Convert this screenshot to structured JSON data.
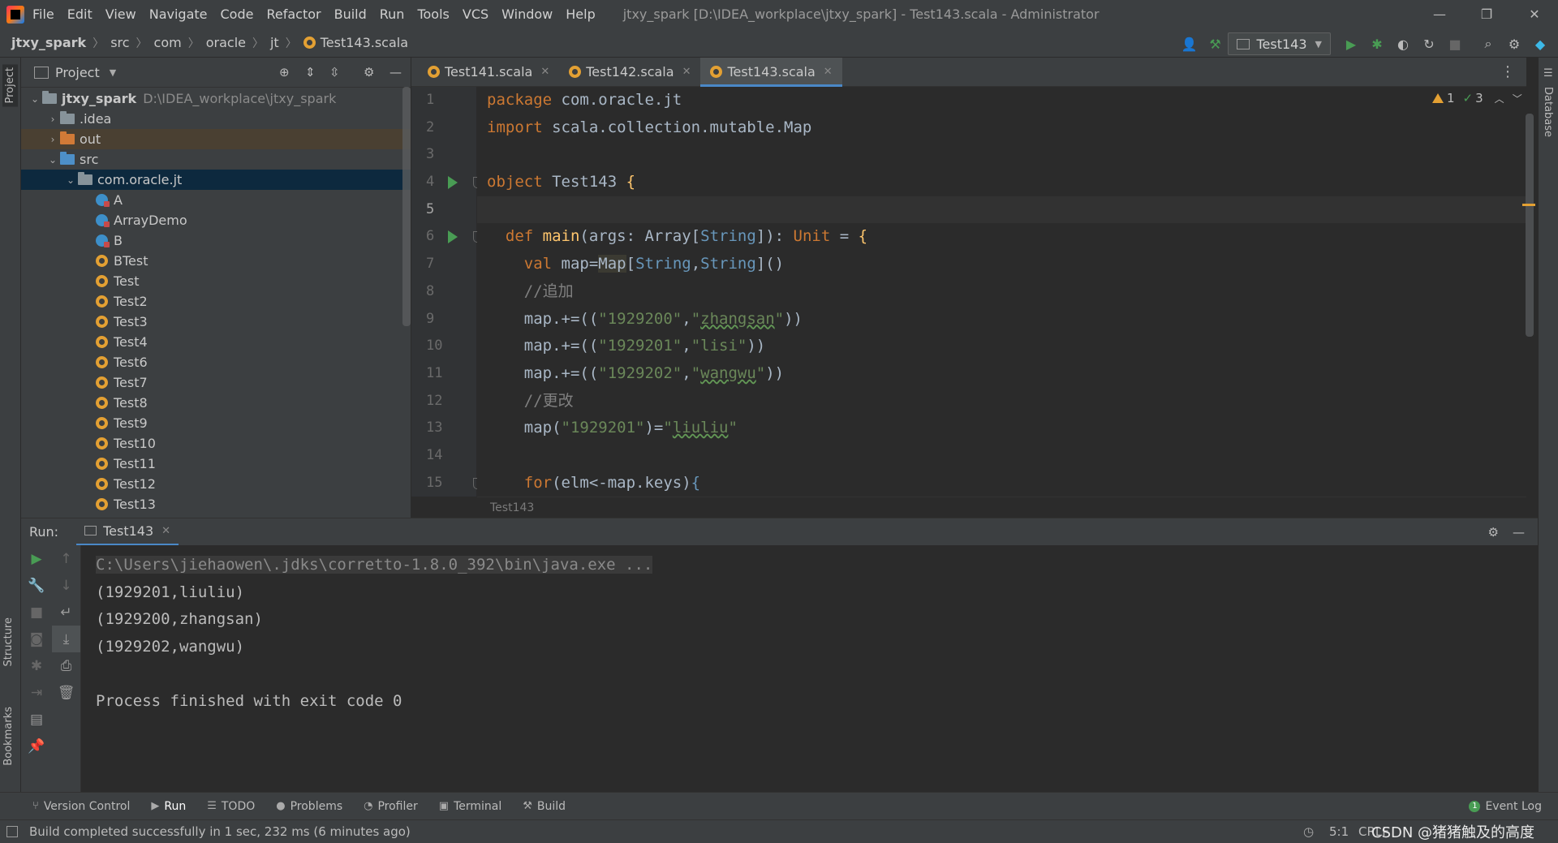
{
  "menu": {
    "items": [
      "File",
      "Edit",
      "View",
      "Navigate",
      "Code",
      "Refactor",
      "Build",
      "Run",
      "Tools",
      "VCS",
      "Window",
      "Help"
    ],
    "window_title": "jtxy_spark [D:\\IDEA_workplace\\jtxy_spark] - Test143.scala - Administrator",
    "minimize": "—",
    "restore": "❐",
    "close": "✕"
  },
  "nav": {
    "crumbs": [
      "jtxy_spark",
      "src",
      "com",
      "oracle",
      "jt",
      "Test143.scala"
    ],
    "run_config": "Test143"
  },
  "project": {
    "title": "Project",
    "tree": [
      {
        "label": "jtxy_spark",
        "extra": "D:\\IDEA_workplace\\jtxy_spark",
        "depth": 0,
        "kind": "module",
        "open": true
      },
      {
        "label": ".idea",
        "depth": 1,
        "kind": "folder",
        "open": false
      },
      {
        "label": "out",
        "depth": 1,
        "kind": "folder-orange",
        "open": false
      },
      {
        "label": "src",
        "depth": 1,
        "kind": "folder-blue",
        "open": true
      },
      {
        "label": "com.oracle.jt",
        "depth": 2,
        "kind": "package",
        "open": true
      },
      {
        "label": "A",
        "depth": 3,
        "kind": "class"
      },
      {
        "label": "ArrayDemo",
        "depth": 3,
        "kind": "class"
      },
      {
        "label": "B",
        "depth": 3,
        "kind": "class"
      },
      {
        "label": "BTest",
        "depth": 3,
        "kind": "object"
      },
      {
        "label": "Test",
        "depth": 3,
        "kind": "object"
      },
      {
        "label": "Test2",
        "depth": 3,
        "kind": "object"
      },
      {
        "label": "Test3",
        "depth": 3,
        "kind": "object"
      },
      {
        "label": "Test4",
        "depth": 3,
        "kind": "object"
      },
      {
        "label": "Test6",
        "depth": 3,
        "kind": "object"
      },
      {
        "label": "Test7",
        "depth": 3,
        "kind": "object"
      },
      {
        "label": "Test8",
        "depth": 3,
        "kind": "object"
      },
      {
        "label": "Test9",
        "depth": 3,
        "kind": "object"
      },
      {
        "label": "Test10",
        "depth": 3,
        "kind": "object"
      },
      {
        "label": "Test11",
        "depth": 3,
        "kind": "object"
      },
      {
        "label": "Test12",
        "depth": 3,
        "kind": "object"
      },
      {
        "label": "Test13",
        "depth": 3,
        "kind": "object"
      }
    ]
  },
  "editor": {
    "tabs": [
      {
        "label": "Test141.scala",
        "active": false
      },
      {
        "label": "Test142.scala",
        "active": false
      },
      {
        "label": "Test143.scala",
        "active": true
      }
    ],
    "line_numbers": [
      "1",
      "2",
      "3",
      "4",
      "5",
      "6",
      "7",
      "8",
      "9",
      "10",
      "11",
      "12",
      "13",
      "14",
      "15"
    ],
    "current_line": "5",
    "warnings": "1",
    "checks": "3",
    "footer": "Test143",
    "lines": {
      "l1a": "package",
      "l1b": " com.oracle.jt",
      "l2a": "import",
      "l2b": " scala.collection.mutable.Map",
      "l4a": "object",
      "l4b": " Test143 ",
      "l4c": "{",
      "l6a": "  def ",
      "l6b": "main",
      "l6c": "(args: Array[",
      "l6d": "String",
      "l6e": "]): ",
      "l6f": "Unit",
      "l6g": " = ",
      "l6h": "{",
      "l7a": "    val ",
      "l7b": "map=",
      "l7c": "Map",
      "l7d": "[",
      "l7e": "String",
      "l7f": ",",
      "l7g": "String",
      "l7h": "]()",
      "l8": "    //追加",
      "l9a": "    map.+=((",
      "l9b": "\"1929200\"",
      "l9c": ",",
      "l9d": "\"",
      "l9e": "zhangsan",
      "l9f": "\"",
      "l9g": "))",
      "l10a": "    map.+=((",
      "l10b": "\"1929201\"",
      "l10c": ",",
      "l10d": "\"lisi\"",
      "l10e": "))",
      "l11a": "    map.+=((",
      "l11b": "\"1929202\"",
      "l11c": ",",
      "l11d": "\"",
      "l11e": "wangwu",
      "l11f": "\"",
      "l11g": "))",
      "l12": "    //更改",
      "l13a": "    map(",
      "l13b": "\"1929201\"",
      "l13c": ")=",
      "l13d": "\"",
      "l13e": "liuliu",
      "l13f": "\"",
      "l15a": "    for",
      "l15b": "(elm<-map.keys)",
      "l15c": "{"
    }
  },
  "run": {
    "label": "Run:",
    "tab": "Test143",
    "output": [
      "C:\\Users\\jiehaowen\\.jdks\\corretto-1.8.0_392\\bin\\java.exe ...",
      "(1929201,liuliu)",
      "(1929200,zhangsan)",
      "(1929202,wangwu)",
      "",
      "Process finished with exit code 0"
    ]
  },
  "side": {
    "project": "Project",
    "structure": "Structure",
    "bookmarks": "Bookmarks",
    "database": "Database"
  },
  "bottom": {
    "tools": [
      "Version Control",
      "Run",
      "TODO",
      "Problems",
      "Profiler",
      "Terminal",
      "Build"
    ],
    "event_log": "Event Log",
    "event_count": "1"
  },
  "status": {
    "message": "Build completed successfully in 1 sec, 232 ms (6 minutes ago)",
    "position": "5:1",
    "encoding": "CRLF",
    "watermark": "CSDN @猪猪触及的高度"
  },
  "colors": {
    "accent": "#4a88c7",
    "run_green": "#499c54",
    "scala_orange": "#e3a033"
  }
}
